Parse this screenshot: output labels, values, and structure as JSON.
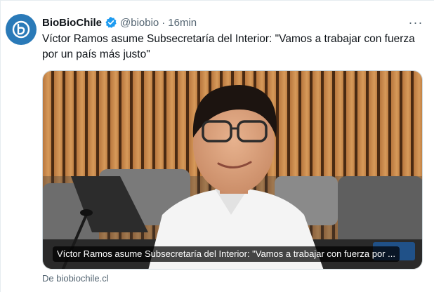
{
  "tweet": {
    "display_name": "BioBioChile",
    "handle": "@biobio",
    "separator": "·",
    "time": "16min",
    "more_label": "···",
    "text": "Víctor Ramos asume Subsecretaría del Interior: \"Vamos a trabajar con fuerza por un país más justo\""
  },
  "card": {
    "title": "Víctor Ramos asume Subsecretaría del Interior: \"Vamos a trabajar con fuerza por ...",
    "source": "De biobiochile.cl"
  },
  "icons": {
    "avatar": "biobio-logo-icon",
    "verified": "verified-badge-icon",
    "more": "more-options-icon"
  },
  "colors": {
    "verified": "#1d9bf0",
    "avatar_bg": "#2a7ab8",
    "secondary_text": "#536471"
  }
}
